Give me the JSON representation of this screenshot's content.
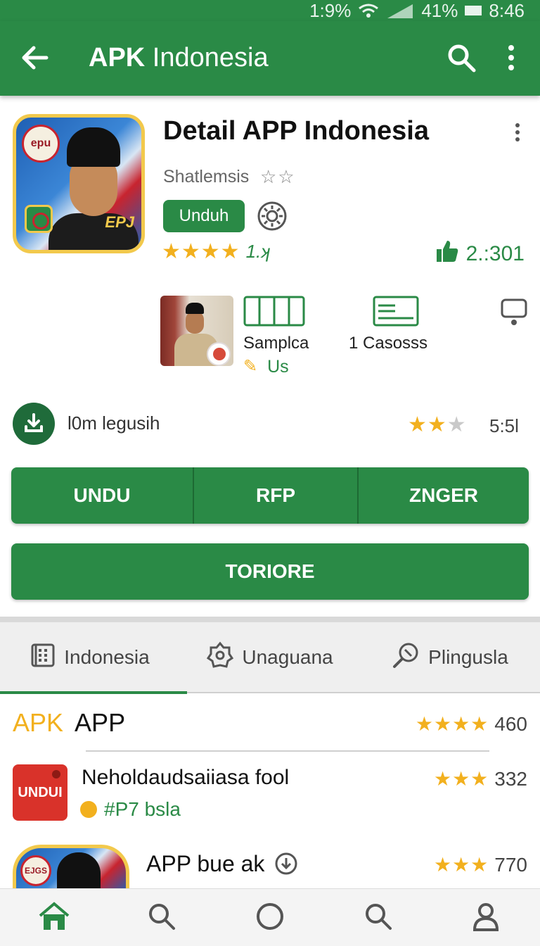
{
  "status_bar": {
    "signal1": "1:9%",
    "battery": "41%",
    "time": "8:46"
  },
  "app_bar": {
    "title_bold": "APK",
    "title_rest": " Indonesia"
  },
  "app": {
    "title": "Detail APP Indonesia",
    "developer": "Shatlemsis",
    "developer_stars": "☆☆",
    "install_chip": "Unduh",
    "icon_badge": "epu",
    "icon_corner": "EPJ",
    "rating_stars": "★★★★",
    "rating_value": "1.ʞ",
    "likes": "2.:301"
  },
  "features": [
    {
      "label": "Samplca",
      "sub": "Us"
    },
    {
      "label": "1 Casosss"
    }
  ],
  "download": {
    "label": "l0m legusih",
    "stars_full": "★★",
    "stars_half": "★",
    "value": "5:5l"
  },
  "buttons": [
    "UNDU",
    "RFP",
    "ZNGER"
  ],
  "wide_button": "TORIORE",
  "tabs": [
    {
      "label": "Indonesia",
      "icon": "grid-book-icon"
    },
    {
      "label": "Unaguana",
      "icon": "badge-icon"
    },
    {
      "label": "Plingusla",
      "icon": "search-tag-icon"
    }
  ],
  "list": {
    "header_apk": "APK",
    "header_app": "APP",
    "header_stars": "★★★★",
    "header_value": "460",
    "items": [
      {
        "icon_text": "UNDUI",
        "title": "Neholdaudsaiiasa fool",
        "sub": "#P7 bsla",
        "stars": "★★★",
        "value": "332"
      },
      {
        "icon_badge": "EJGS",
        "title": "APP bue ak",
        "stars": "★★★",
        "value": "770"
      }
    ]
  },
  "colors": {
    "primary": "#2a8a46",
    "star": "#f2b01e",
    "accent_red": "#d9322a"
  }
}
